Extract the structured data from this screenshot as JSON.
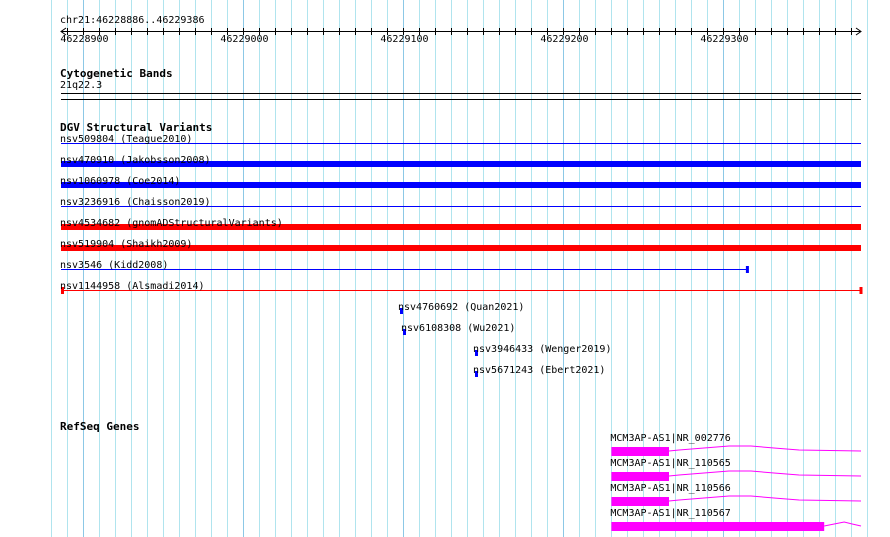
{
  "region": {
    "chrom": "chr21",
    "start": 46228886,
    "end": 46229386,
    "label": "chr21:46228886..46229386"
  },
  "ruler": {
    "ticks": [
      "46228900",
      "46229000",
      "46229100",
      "46229200",
      "46229300"
    ]
  },
  "tracks": {
    "cytoband": {
      "title": "Cytogenetic Bands",
      "band": "21q22.3"
    },
    "dgv": {
      "title": "DGV Structural Variants",
      "items": [
        {
          "label": "nsv509804 (Teague2010)",
          "start": 46228886,
          "end": 46229386,
          "color": "#0000ff",
          "style": "thin"
        },
        {
          "label": "nsv470910 (Jakobsson2008)",
          "start": 46228886,
          "end": 46229386,
          "color": "#0000ff",
          "style": "thick"
        },
        {
          "label": "nsv1060978 (Coe2014)",
          "start": 46228886,
          "end": 46229386,
          "color": "#0000ff",
          "style": "thick"
        },
        {
          "label": "nsv3236916 (Chaisson2019)",
          "start": 46228886,
          "end": 46229386,
          "color": "#0000ff",
          "style": "thin"
        },
        {
          "label": "nsv4534682 (gnomADStructuralVariants)",
          "start": 46228886,
          "end": 46229386,
          "color": "#ff0000",
          "style": "thick"
        },
        {
          "label": "nsv519904 (Shaikh2009)",
          "start": 46228886,
          "end": 46229386,
          "color": "#ff0000",
          "style": "thick"
        },
        {
          "label": "nsv3546 (Kidd2008)",
          "start": 46228886,
          "end": 46229315,
          "color": "#0000ff",
          "style": "thin-end"
        },
        {
          "label": "nsv1144958 (Alsmadi2014)",
          "start": 46228886,
          "end": 46229386,
          "color": "#ff0000",
          "style": "thin-both"
        },
        {
          "label": "nsv4760692 (Quan2021)",
          "start": 46229098,
          "end": 46229099,
          "color": "#0000ff",
          "style": "small"
        },
        {
          "label": "nsv6108308 (Wu2021)",
          "start": 46229100,
          "end": 46229101,
          "color": "#0000ff",
          "style": "small"
        },
        {
          "label": "nsv3946433 (Wenger2019)",
          "start": 46229145,
          "end": 46229146,
          "color": "#0000ff",
          "style": "small"
        },
        {
          "label": "nsv5671243 (Ebert2021)",
          "start": 46229145,
          "end": 46229146,
          "color": "#0000ff",
          "style": "small"
        }
      ]
    },
    "refseq": {
      "title": "RefSeq Genes",
      "color": "#ff00ff",
      "genes": [
        {
          "label": "MCM3AP-AS1|NR_002776",
          "exon_start": 46229230,
          "exon_end": 46229266
        },
        {
          "label": "MCM3AP-AS1|NR_110565",
          "exon_start": 46229230,
          "exon_end": 46229266
        },
        {
          "label": "MCM3AP-AS1|NR_110566",
          "exon_start": 46229230,
          "exon_end": 46229266
        },
        {
          "label": "MCM3AP-AS1|NR_110567",
          "exon_start": 46229230,
          "exon_end": 46229363
        }
      ]
    }
  }
}
